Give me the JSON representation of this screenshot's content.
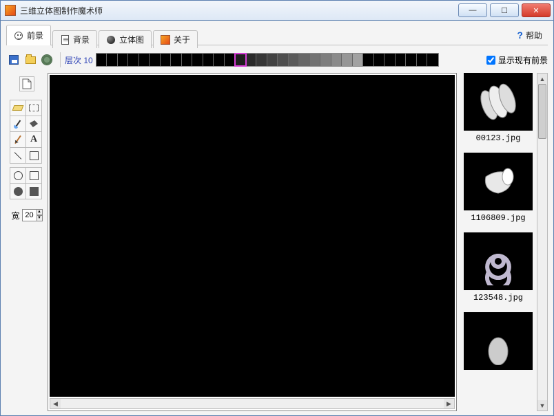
{
  "window": {
    "title": "三维立体图制作魔术师"
  },
  "tabs": {
    "items": [
      {
        "label": "前景",
        "icon": "smiley-icon",
        "active": true
      },
      {
        "label": "背景",
        "icon": "document-icon",
        "active": false
      },
      {
        "label": "立体图",
        "icon": "sphere-icon",
        "active": false
      },
      {
        "label": "关于",
        "icon": "about-icon",
        "active": false
      }
    ],
    "help_label": "帮助"
  },
  "toolbar": {
    "save_tip": "保存",
    "open_tip": "打开",
    "settings_tip": "设置",
    "layer_label": "层次 10",
    "layer_count": 32,
    "layer_selected_index": 13,
    "show_foreground_label": "显示现有前景",
    "show_foreground_checked": true
  },
  "toolbox": {
    "new_doc": "new-document",
    "tools": [
      [
        "eraser-tool",
        "marquee-tool"
      ],
      [
        "eyedropper-tool",
        "fill-tool"
      ],
      [
        "pencil-tool",
        "text-tool"
      ],
      [
        "line-tool",
        "rectangle-tool"
      ],
      [
        "circle-outline-tool",
        "square-outline-tool"
      ],
      [
        "circle-fill-tool",
        "square-fill-tool"
      ]
    ],
    "width_label": "宽",
    "width_value": "20"
  },
  "gallery": {
    "items": [
      {
        "label": "00123.jpg",
        "shape": "rings"
      },
      {
        "label": "1106809.jpg",
        "shape": "cone"
      },
      {
        "label": "123548.jpg",
        "shape": "biohazard"
      },
      {
        "label": "",
        "shape": "partial"
      }
    ]
  },
  "icons": {
    "minimize": "—",
    "maximize": "☐",
    "close": "✕",
    "help_mark": "?"
  }
}
